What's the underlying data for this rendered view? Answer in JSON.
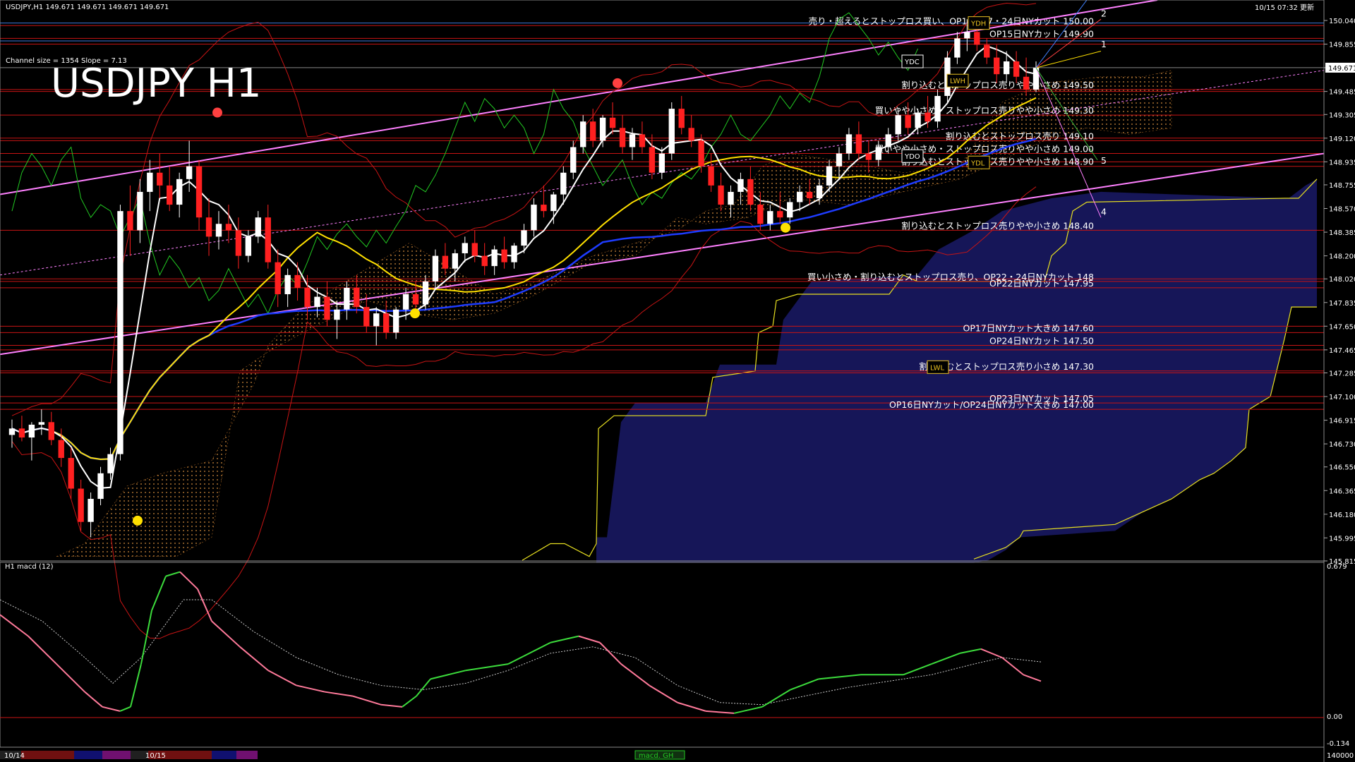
{
  "header": {
    "symbol_info": "USDJPY,H1  149.671 149.671 149.671 149.671",
    "channel_info": "Channel size = 1354  Slope = 7.13",
    "big_title": "USDJPY H1",
    "datetime": "10/15 07:32 更新"
  },
  "macd_panel": {
    "label": "H1  macd (12)",
    "axis_labels": [
      "0.679",
      "0.00",
      "-0.134"
    ],
    "bottom_right": "140000",
    "bottom_center": "macd. GH"
  },
  "timeline": {
    "labels": [
      "10/14",
      "10/15"
    ]
  },
  "colors": {
    "background": "#000000",
    "resistance_lines": "#c81414",
    "channel": "#ff80ff",
    "kumo": "#2828a0",
    "ma_white": "#ffffff",
    "ma_yellow": "#ffe000",
    "ma_blue": "#1e3cff",
    "bollinger": "#c81414",
    "chikou": "#22c822",
    "macd_rise": "#3cdc3c",
    "macd_fall": "#ff7a9a"
  },
  "chart_data": {
    "type": "line",
    "title": "USDJPY H1",
    "ylim": [
      145.815,
      150.2
    ],
    "price_ticks": [
      "150.040",
      "149.855",
      "149.671",
      "149.485",
      "149.305",
      "149.120",
      "148.935",
      "148.755",
      "148.570",
      "148.385",
      "148.200",
      "148.020",
      "147.835",
      "147.650",
      "147.465",
      "147.285",
      "147.100",
      "146.915",
      "146.730",
      "146.550",
      "146.365",
      "146.180",
      "145.995",
      "145.815"
    ],
    "current_price": "149.671",
    "candles": [
      [
        146.8,
        146.92,
        146.7,
        146.85
      ],
      [
        146.85,
        146.95,
        146.75,
        146.78
      ],
      [
        146.78,
        146.9,
        146.6,
        146.88
      ],
      [
        146.88,
        147.0,
        146.8,
        146.9
      ],
      [
        146.9,
        146.98,
        146.72,
        146.76
      ],
      [
        146.76,
        146.85,
        146.55,
        146.62
      ],
      [
        146.62,
        146.7,
        146.3,
        146.38
      ],
      [
        146.38,
        146.45,
        146.05,
        146.12
      ],
      [
        146.12,
        146.35,
        146.0,
        146.3
      ],
      [
        146.3,
        146.55,
        146.25,
        146.5
      ],
      [
        146.5,
        146.7,
        146.45,
        146.65
      ],
      [
        146.65,
        148.6,
        146.6,
        148.55
      ],
      [
        148.55,
        148.75,
        148.2,
        148.4
      ],
      [
        148.4,
        148.8,
        148.3,
        148.7
      ],
      [
        148.7,
        148.95,
        148.55,
        148.85
      ],
      [
        148.85,
        149.0,
        148.65,
        148.75
      ],
      [
        148.75,
        148.9,
        148.55,
        148.6
      ],
      [
        148.6,
        148.85,
        148.5,
        148.8
      ],
      [
        148.8,
        149.1,
        148.7,
        148.9
      ],
      [
        148.9,
        148.95,
        148.4,
        148.5
      ],
      [
        148.5,
        148.65,
        148.2,
        148.35
      ],
      [
        148.35,
        148.55,
        148.25,
        148.45
      ],
      [
        148.45,
        148.6,
        148.3,
        148.4
      ],
      [
        148.4,
        148.5,
        148.1,
        148.2
      ],
      [
        148.2,
        148.4,
        148.15,
        148.35
      ],
      [
        148.35,
        148.55,
        148.3,
        148.5
      ],
      [
        148.5,
        148.6,
        148.1,
        148.15
      ],
      [
        148.15,
        148.25,
        147.8,
        147.9
      ],
      [
        147.9,
        148.1,
        147.8,
        148.05
      ],
      [
        148.05,
        148.15,
        147.85,
        147.95
      ],
      [
        147.95,
        148.05,
        147.7,
        147.8
      ],
      [
        147.8,
        147.95,
        147.72,
        147.88
      ],
      [
        147.88,
        148.0,
        147.65,
        147.7
      ],
      [
        147.7,
        147.85,
        147.55,
        147.78
      ],
      [
        147.78,
        148.0,
        147.7,
        147.95
      ],
      [
        147.95,
        148.05,
        147.75,
        147.8
      ],
      [
        147.8,
        147.9,
        147.6,
        147.65
      ],
      [
        147.65,
        147.8,
        147.5,
        147.75
      ],
      [
        147.75,
        147.85,
        147.55,
        147.6
      ],
      [
        147.6,
        147.8,
        147.55,
        147.78
      ],
      [
        147.78,
        147.95,
        147.7,
        147.9
      ],
      [
        147.9,
        148.0,
        147.75,
        147.82
      ],
      [
        147.82,
        148.05,
        147.78,
        148.0
      ],
      [
        148.0,
        148.25,
        147.95,
        148.2
      ],
      [
        148.2,
        148.3,
        148.05,
        148.1
      ],
      [
        148.1,
        148.25,
        148.0,
        148.22
      ],
      [
        148.22,
        148.35,
        148.15,
        148.3
      ],
      [
        148.3,
        148.4,
        148.15,
        148.2
      ],
      [
        148.2,
        148.3,
        148.05,
        148.12
      ],
      [
        148.12,
        148.28,
        148.05,
        148.25
      ],
      [
        148.25,
        148.35,
        148.1,
        148.15
      ],
      [
        148.15,
        148.3,
        148.1,
        148.28
      ],
      [
        148.28,
        148.45,
        148.22,
        148.4
      ],
      [
        148.4,
        148.65,
        148.35,
        148.6
      ],
      [
        148.6,
        148.75,
        148.5,
        148.55
      ],
      [
        148.55,
        148.7,
        148.45,
        148.68
      ],
      [
        148.68,
        148.9,
        148.6,
        148.85
      ],
      [
        148.85,
        149.1,
        148.8,
        149.05
      ],
      [
        149.05,
        149.3,
        149.0,
        149.25
      ],
      [
        149.25,
        149.35,
        149.05,
        149.1
      ],
      [
        149.1,
        149.3,
        149.05,
        149.28
      ],
      [
        149.28,
        149.4,
        149.15,
        149.2
      ],
      [
        149.2,
        149.3,
        149.0,
        149.05
      ],
      [
        149.05,
        149.2,
        148.95,
        149.15
      ],
      [
        149.15,
        149.25,
        149.0,
        149.05
      ],
      [
        149.05,
        149.15,
        148.8,
        148.85
      ],
      [
        148.85,
        149.05,
        148.8,
        149.0
      ],
      [
        149.0,
        149.4,
        148.95,
        149.35
      ],
      [
        149.35,
        149.45,
        149.15,
        149.2
      ],
      [
        149.2,
        149.3,
        149.05,
        149.1
      ],
      [
        149.1,
        149.15,
        148.85,
        148.9
      ],
      [
        148.9,
        149.0,
        148.7,
        148.75
      ],
      [
        148.75,
        148.85,
        148.55,
        148.6
      ],
      [
        148.6,
        148.75,
        148.5,
        148.7
      ],
      [
        148.7,
        148.85,
        148.6,
        148.8
      ],
      [
        148.8,
        148.9,
        148.55,
        148.6
      ],
      [
        148.6,
        148.7,
        148.4,
        148.45
      ],
      [
        148.45,
        148.6,
        148.4,
        148.55
      ],
      [
        148.55,
        148.7,
        148.45,
        148.5
      ],
      [
        148.5,
        148.65,
        148.45,
        148.62
      ],
      [
        148.62,
        148.75,
        148.55,
        148.7
      ],
      [
        148.7,
        148.8,
        148.6,
        148.65
      ],
      [
        148.65,
        148.8,
        148.6,
        148.75
      ],
      [
        148.75,
        148.95,
        148.7,
        148.9
      ],
      [
        148.9,
        149.05,
        148.8,
        149.0
      ],
      [
        149.0,
        149.2,
        148.95,
        149.15
      ],
      [
        149.15,
        149.25,
        148.95,
        149.0
      ],
      [
        149.0,
        149.1,
        148.85,
        148.95
      ],
      [
        148.95,
        149.1,
        148.9,
        149.05
      ],
      [
        149.05,
        149.2,
        149.0,
        149.15
      ],
      [
        149.15,
        149.35,
        149.1,
        149.3
      ],
      [
        149.3,
        149.4,
        149.15,
        149.2
      ],
      [
        149.2,
        149.35,
        149.15,
        149.32
      ],
      [
        149.32,
        149.45,
        149.2,
        149.25
      ],
      [
        149.25,
        149.5,
        149.2,
        149.45
      ],
      [
        149.45,
        149.8,
        149.4,
        149.75
      ],
      [
        149.75,
        149.95,
        149.7,
        149.9
      ],
      [
        149.9,
        150.05,
        149.8,
        149.95
      ],
      [
        149.95,
        150.0,
        149.8,
        149.85
      ],
      [
        149.85,
        149.9,
        149.7,
        149.75
      ],
      [
        149.75,
        149.85,
        149.55,
        149.62
      ],
      [
        149.62,
        149.8,
        149.55,
        149.72
      ],
      [
        149.72,
        149.8,
        149.55,
        149.6
      ],
      [
        149.6,
        149.75,
        149.45,
        149.5
      ],
      [
        149.5,
        149.72,
        149.48,
        149.67
      ]
    ],
    "levels": [
      {
        "price": 150.0,
        "label": "売り・超えるとストップロス買い、OP16・17・24日NYカット 150.00"
      },
      {
        "price": 149.9,
        "label": "OP15日NYカット 149.90"
      },
      {
        "price": 149.5,
        "label": "割り込むとストップロス売りやや小さめ 149.50"
      },
      {
        "price": 149.3,
        "label": "買いやや小さめ・ストップロス売りやや小さめ 149.30"
      },
      {
        "price": 149.1,
        "label": "割り込むとストップロス売り 149.10"
      },
      {
        "price": 149.0,
        "label": "買いやや小さめ・ストップロス売りやや小さめ 149.00"
      },
      {
        "price": 148.9,
        "label": "割り込むとストップロス売りやや小さめ 148.90"
      },
      {
        "price": 148.4,
        "label": "割り込むとストップロス売りやや小さめ 148.40"
      },
      {
        "price": 148.0,
        "label": "買い小さめ・割り込むとストップロス売り、OP22・24日NYカット 148"
      },
      {
        "price": 147.95,
        "label": "OP22日NYカット 147.95"
      },
      {
        "price": 147.6,
        "label": "OP17日NYカット大きめ 147.60"
      },
      {
        "price": 147.5,
        "label": "OP24日NYカット 147.50"
      },
      {
        "price": 147.3,
        "label": "割り込むとストップロス売り小さめ 147.30"
      },
      {
        "price": 147.05,
        "label": "OP23日NYカット 147.05"
      },
      {
        "price": 147.0,
        "label": "OP16日NYカット/OP24日NYカット大きめ 147.00"
      }
    ],
    "projection_labels": [
      "1",
      "2",
      "4",
      "5"
    ],
    "boxes": [
      "YDC",
      "YDO",
      "YDH",
      "YDL",
      "LWH",
      "LWL"
    ]
  }
}
